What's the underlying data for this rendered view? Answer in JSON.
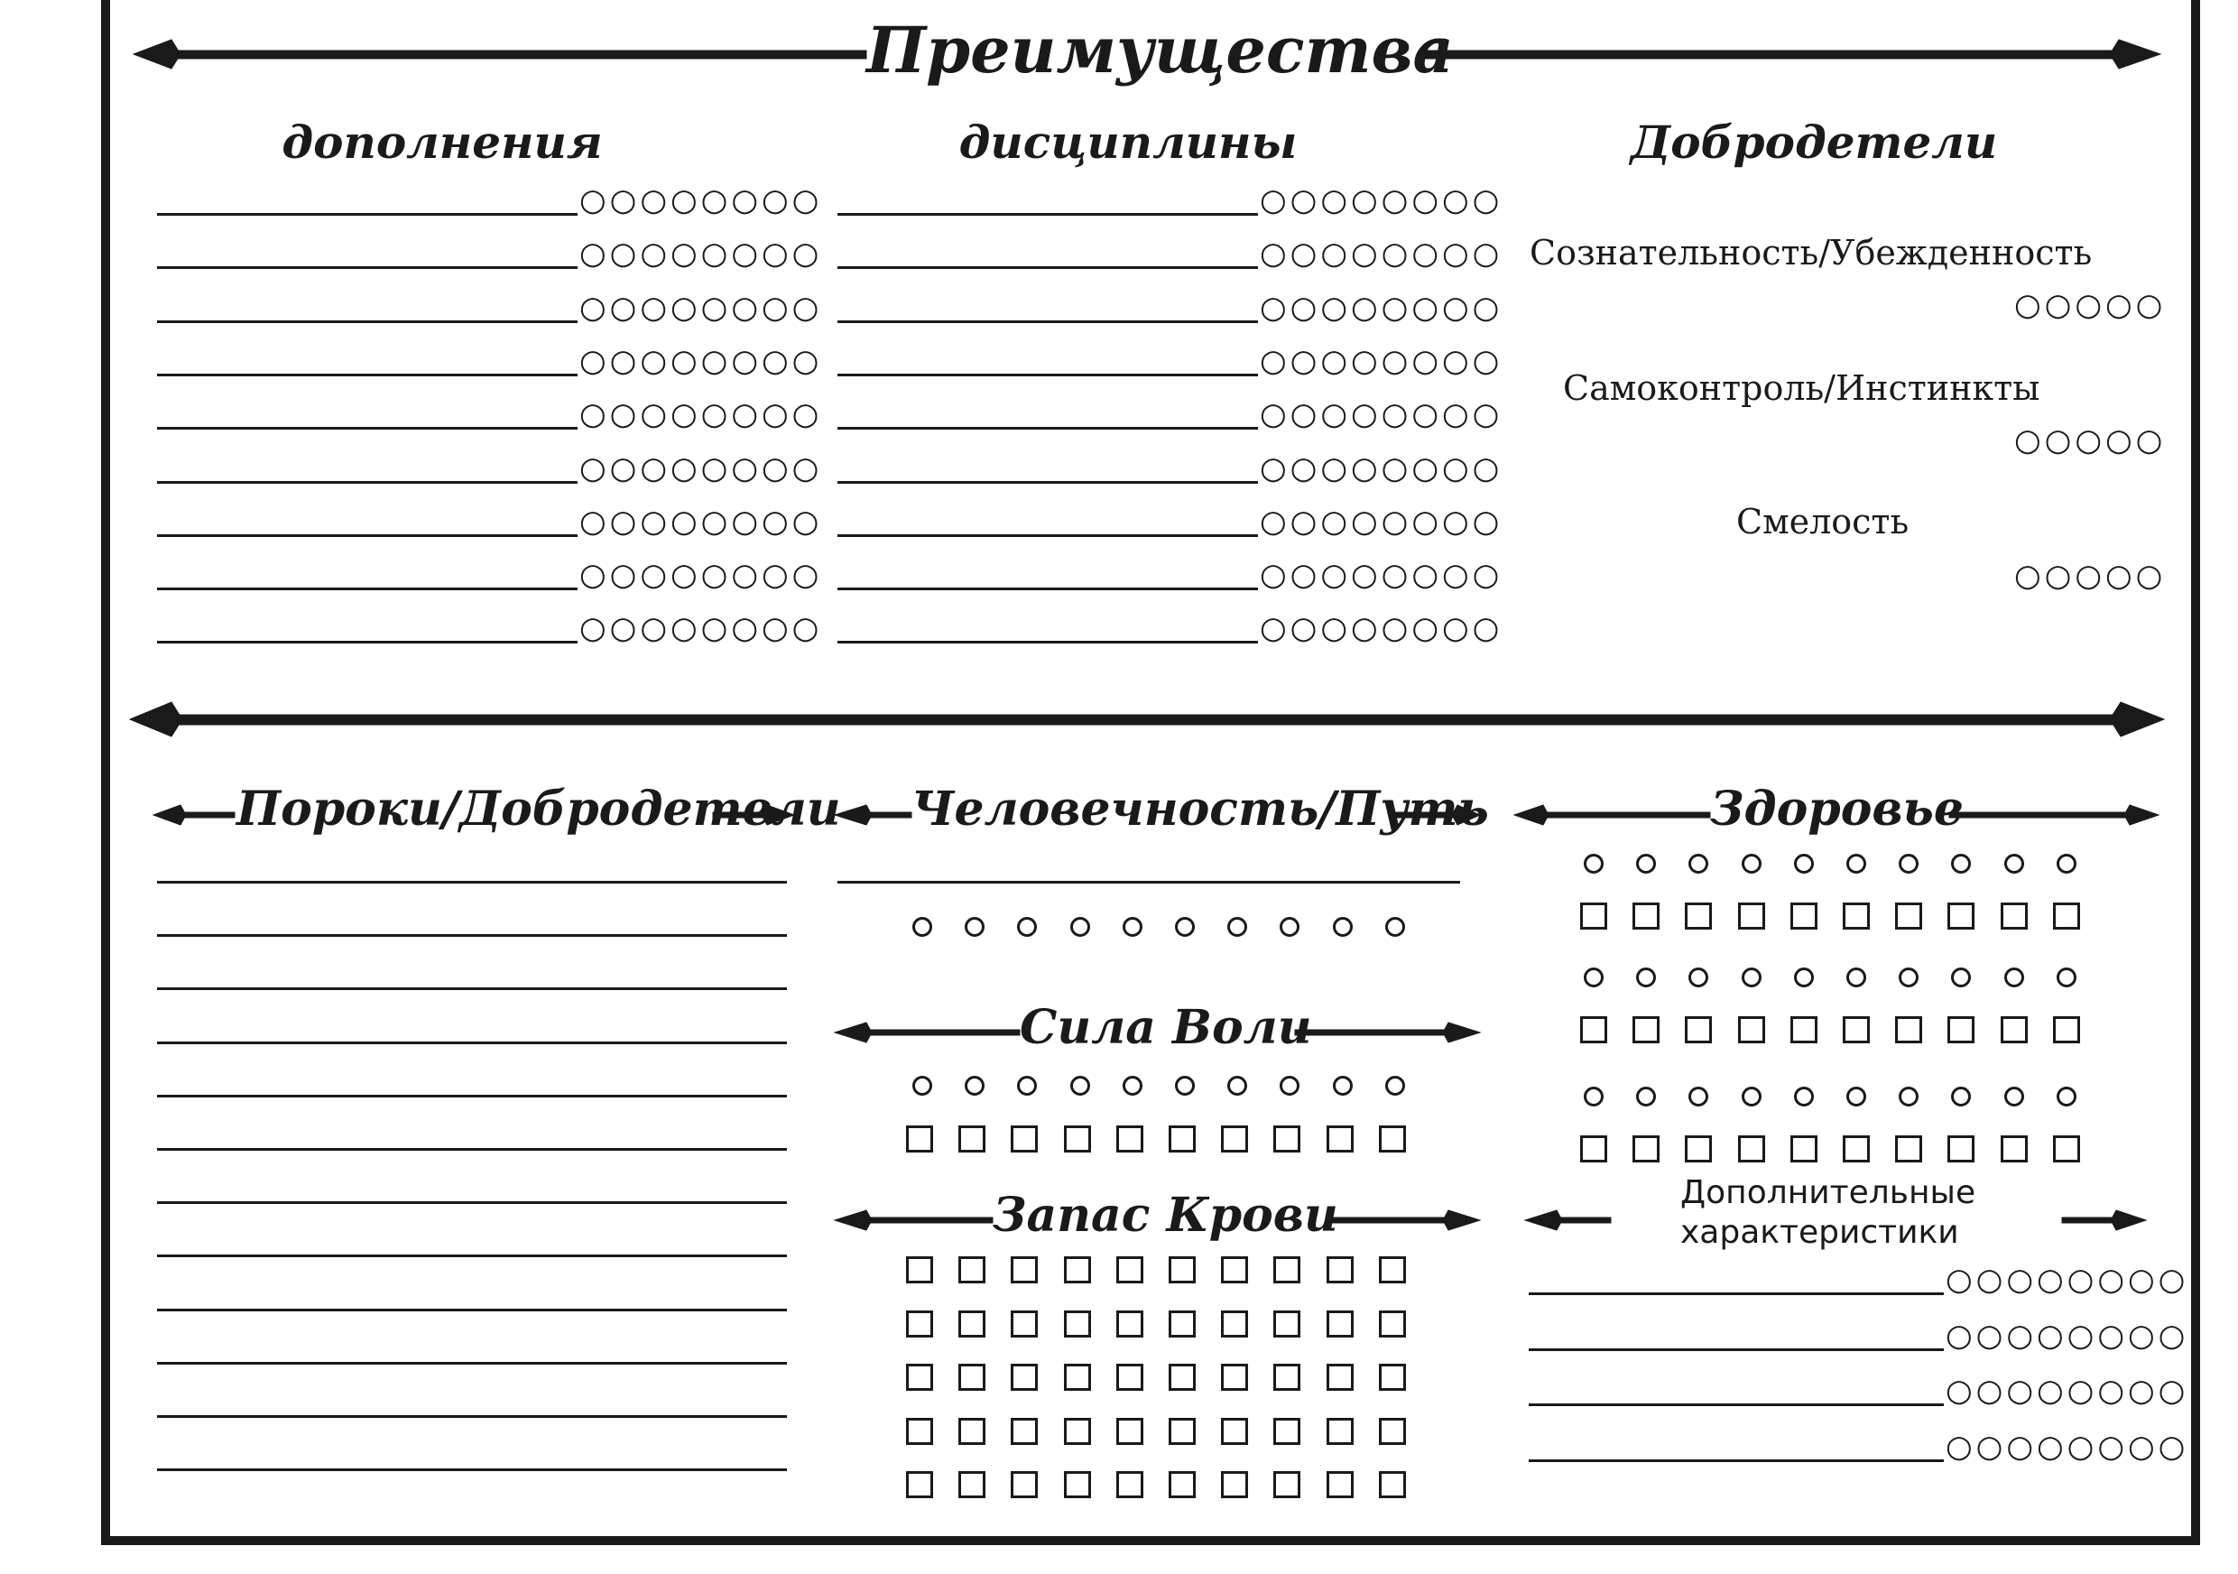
{
  "titles": {
    "advantages": "Преимущества",
    "backgrounds": "дополнения",
    "disciplines": "дисциплины",
    "virtues": "Добродетели",
    "vices": "Пороки/Добродетели",
    "humanity": "Человечность/Путь",
    "willpower": "Сила Воли",
    "blood_pool": "Запас Крови",
    "health": "Здоровье",
    "extra": "Дополнительные характеристики"
  },
  "virtues": [
    {
      "label": "Сознательность/Убежденность",
      "dots": "○○○○○"
    },
    {
      "label": "Самоконтроль/Инстинкты",
      "dots": "○○○○○"
    },
    {
      "label": "Смелость",
      "dots": "○○○○○"
    }
  ],
  "trait_dots": "○○○○○○○○",
  "counts": {
    "backgrounds_rows": 9,
    "disciplines_rows": 9,
    "vices_lines": 12,
    "humanity_circles": 10,
    "willpower_circles": 10,
    "willpower_squares": 10,
    "blood_rows": 5,
    "blood_cols": 10,
    "health_rows": 3,
    "health_cols": 10,
    "extra_rows": 4
  }
}
